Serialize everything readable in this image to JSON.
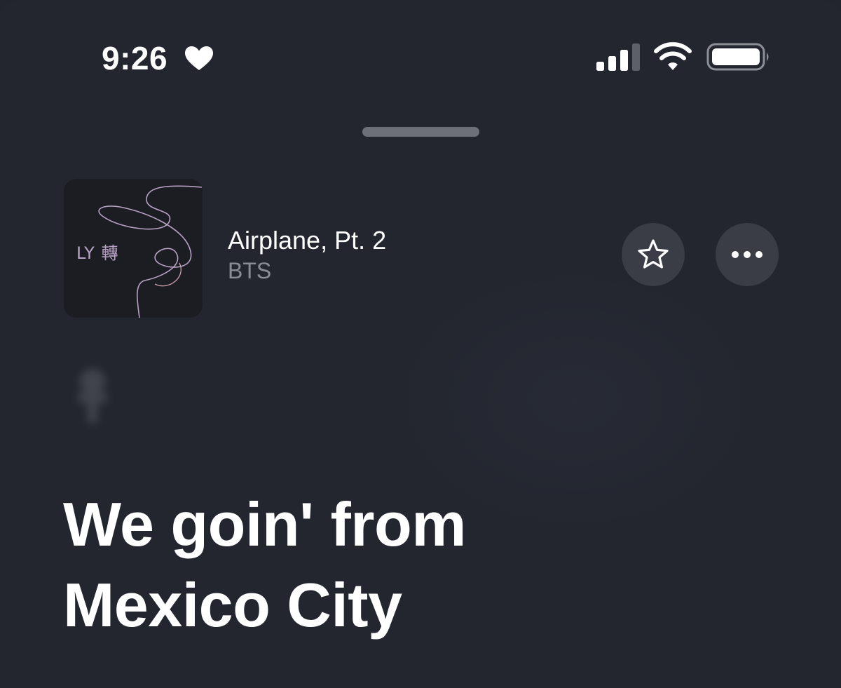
{
  "status_bar": {
    "time": "9:26",
    "icons": [
      "heart-icon",
      "cellular-signal-icon",
      "wifi-icon",
      "battery-icon"
    ]
  },
  "now_playing": {
    "artwork_text": "LY 轉",
    "title": "Airplane, Pt. 2",
    "artist": "BTS",
    "favorite_icon": "star-icon",
    "more_icon": "ellipsis-icon"
  },
  "lyrics": {
    "lines": [
      "We goin' from",
      "Mexico City"
    ]
  },
  "colors": {
    "background": "#23262f",
    "text_primary": "#ffffff",
    "text_secondary": "#8a8d96",
    "button_bg": "#3a3d46"
  }
}
